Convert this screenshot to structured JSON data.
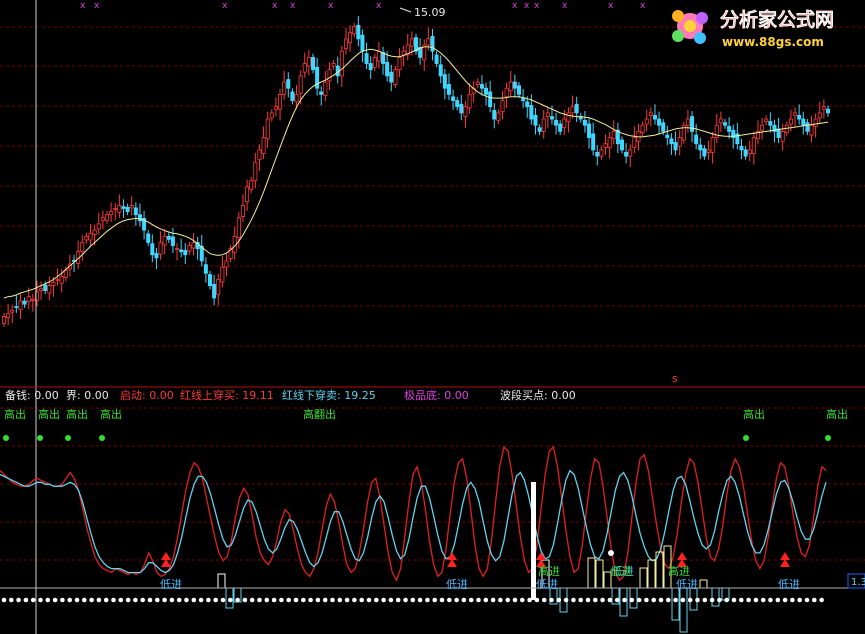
{
  "logo": {
    "title": "分析家公式网",
    "url": "www.88gs.com"
  },
  "colors": {
    "bg": "#000000",
    "grid": "#7a0000",
    "candle_up": "#ff3a3a",
    "candle_down": "#3fd7ff",
    "ma": "#f2ef9c",
    "osc_red": "#e02020",
    "osc_cyan": "#5fd3ee",
    "high_dot": "#33dd33",
    "high_label": "#33dd33",
    "low_label": "#49b7ff",
    "arrow": "#ff2020",
    "dotline": "#ffffff",
    "magenta": "#e040e0",
    "text_white": "#e8e8e8",
    "text_red": "#ff3a3a"
  },
  "top_panel": {
    "peak_label": "15.09",
    "top_mark": "x",
    "bottom_mark": "s"
  },
  "indicator_header": [
    {
      "label": "备钱:",
      "value": "0.00",
      "color": "#e8e8e8"
    },
    {
      "label": "界:",
      "value": "0.00",
      "color": "#e8e8e8"
    },
    {
      "label": "启动:",
      "value": "0.00",
      "color": "#ff3a3a"
    },
    {
      "label": "红线上穿买:",
      "value": "19.11",
      "color": "#ff3a3a"
    },
    {
      "label": "红线下穿卖:",
      "value": "19.25",
      "color": "#5fd3ee"
    },
    {
      "label": "极品底:",
      "value": "0.00",
      "color": "#e040e0"
    },
    {
      "label": "波段买点:",
      "value": "0.00",
      "color": "#e8e8e8"
    }
  ],
  "bottom_panel": {
    "right_value": "1.3",
    "high_labels": [
      "高出",
      "高出",
      "高出",
      "高出",
      "高翻出",
      "高出",
      "高出"
    ],
    "low_labels": [
      "低进",
      "低进",
      "低进",
      "低进",
      "低进",
      "低进"
    ],
    "green_labels": [
      "高进",
      "低进",
      "高进"
    ]
  },
  "chart_data": [
    {
      "type": "candlestick",
      "title": "",
      "peak_price": 15.09,
      "candles_count": 205,
      "grid": true,
      "ma_series": [
        {
          "name": "",
          "values": [
            10.6,
            10.62,
            10.63,
            10.65,
            10.68,
            10.7,
            10.72,
            10.74,
            10.77,
            10.8,
            10.83,
            10.86,
            10.9,
            10.95,
            11.0,
            11.06,
            11.12,
            11.18,
            11.24,
            11.3,
            11.37,
            11.44,
            11.5,
            11.56,
            11.62,
            11.68,
            11.73,
            11.78,
            11.82,
            11.85,
            11.87,
            11.88,
            11.89,
            11.88,
            11.86,
            11.83,
            11.79,
            11.75,
            11.72,
            11.69,
            11.67,
            11.65,
            11.64,
            11.62,
            11.6,
            11.57,
            11.53,
            11.48,
            11.42,
            11.37,
            11.32,
            11.3,
            11.29,
            11.3,
            11.33,
            11.38,
            11.44,
            11.52,
            11.62,
            11.74,
            11.86,
            12.0,
            12.15,
            12.32,
            12.5,
            12.68,
            12.86,
            13.04,
            13.22,
            13.39,
            13.55,
            13.69,
            13.81,
            13.9,
            13.97,
            14.03,
            14.07,
            14.1,
            14.13,
            14.17,
            14.21,
            14.26,
            14.31,
            14.37,
            14.44,
            14.5,
            14.56,
            14.6,
            14.62,
            14.63,
            14.62,
            14.6,
            14.57,
            14.54,
            14.52,
            14.51,
            14.51,
            14.53,
            14.56,
            14.59,
            14.62,
            14.65,
            14.67,
            14.67,
            14.66,
            14.62,
            14.57,
            14.51,
            14.44,
            14.36,
            14.28,
            14.2,
            14.12,
            14.05,
            13.99,
            13.94,
            13.9,
            13.87,
            13.85,
            13.84,
            13.84,
            13.84,
            13.85,
            13.86,
            13.86,
            13.86,
            13.85,
            13.83,
            13.81,
            13.78,
            13.75,
            13.72,
            13.69,
            13.66,
            13.63,
            13.6,
            13.58,
            13.56,
            13.55,
            13.54,
            13.54,
            13.53,
            13.52,
            13.5,
            13.47,
            13.44,
            13.41,
            13.37,
            13.33,
            13.3,
            13.27,
            13.25,
            13.23,
            13.22,
            13.21,
            13.21,
            13.22,
            13.23,
            13.24,
            13.26,
            13.28,
            13.3,
            13.32,
            13.34,
            13.35,
            13.36,
            13.36,
            13.35,
            13.34,
            13.32,
            13.3,
            13.28,
            13.26,
            13.24,
            13.23,
            13.22,
            13.22,
            13.22,
            13.23,
            13.24,
            13.25,
            13.26,
            13.27,
            13.28,
            13.29,
            13.3,
            13.31,
            13.32,
            13.33,
            13.34,
            13.35,
            13.36,
            13.37,
            13.38,
            13.39,
            13.4,
            13.41,
            13.42,
            13.43,
            13.44,
            13.45
          ]
        }
      ],
      "closes": [
        10.3,
        10.35,
        10.4,
        10.45,
        10.55,
        10.5,
        10.62,
        10.58,
        10.7,
        10.75,
        10.72,
        10.8,
        10.85,
        10.9,
        10.95,
        11.05,
        11.15,
        11.2,
        11.35,
        11.5,
        11.6,
        11.65,
        11.7,
        11.8,
        11.9,
        11.95,
        12.0,
        12.05,
        12.1,
        12.05,
        12.0,
        12.1,
        11.95,
        11.85,
        11.7,
        11.5,
        11.3,
        11.25,
        11.5,
        11.6,
        11.55,
        11.45,
        11.4,
        11.35,
        11.3,
        11.45,
        11.5,
        11.4,
        11.2,
        11.0,
        10.8,
        10.6,
        10.9,
        11.1,
        11.2,
        11.4,
        11.6,
        11.9,
        12.1,
        12.4,
        12.5,
        12.8,
        13.0,
        13.2,
        13.5,
        13.6,
        13.7,
        13.9,
        14.1,
        14.0,
        13.8,
        13.9,
        14.2,
        14.4,
        14.5,
        14.3,
        14.0,
        13.9,
        14.1,
        14.3,
        14.4,
        14.2,
        14.6,
        14.8,
        14.9,
        15.0,
        14.8,
        14.6,
        14.4,
        14.3,
        14.5,
        14.6,
        14.4,
        14.2,
        14.1,
        14.3,
        14.5,
        14.6,
        14.7,
        14.8,
        14.6,
        14.5,
        14.7,
        14.8,
        14.6,
        14.4,
        14.2,
        14.0,
        13.9,
        13.8,
        13.7,
        13.6,
        13.7,
        13.9,
        14.0,
        14.1,
        14.0,
        13.9,
        13.7,
        13.5,
        13.6,
        13.8,
        14.0,
        14.1,
        14.0,
        13.9,
        13.8,
        13.7,
        13.5,
        13.4,
        13.3,
        13.5,
        13.6,
        13.5,
        13.4,
        13.3,
        13.5,
        13.6,
        13.7,
        13.6,
        13.5,
        13.4,
        13.2,
        13.0,
        12.9,
        13.0,
        13.1,
        13.2,
        13.3,
        13.1,
        13.0,
        12.9,
        13.0,
        13.2,
        13.3,
        13.4,
        13.5,
        13.6,
        13.5,
        13.4,
        13.3,
        13.2,
        13.1,
        13.0,
        13.2,
        13.4,
        13.5,
        13.3,
        13.1,
        13.0,
        12.9,
        13.0,
        13.2,
        13.4,
        13.5,
        13.4,
        13.3,
        13.2,
        13.1,
        13.0,
        12.9,
        13.0,
        13.2,
        13.3,
        13.4,
        13.5,
        13.4,
        13.3,
        13.2,
        13.3,
        13.4,
        13.5,
        13.6,
        13.5,
        13.4,
        13.3,
        13.4,
        13.5,
        13.6,
        13.7,
        13.6
      ]
    },
    {
      "type": "line",
      "title": "",
      "series": [
        {
          "name": "",
          "values": [
            64,
            62,
            60,
            58,
            57,
            56,
            56,
            57,
            59,
            60,
            59,
            58,
            57,
            56,
            56,
            57,
            60,
            63,
            60,
            54,
            45,
            35,
            27,
            20,
            16,
            14,
            13,
            12,
            14,
            13,
            12,
            11,
            12,
            11,
            12,
            16,
            22,
            18,
            12,
            10,
            11,
            14,
            20,
            30,
            42,
            54,
            63,
            68,
            66,
            60,
            50,
            40,
            30,
            22,
            18,
            20,
            28,
            40,
            50,
            55,
            52,
            42,
            30,
            22,
            18,
            16,
            20,
            28,
            38,
            44,
            42,
            34,
            24,
            16,
            12,
            10,
            14,
            22,
            34,
            46,
            52,
            48,
            38,
            26,
            16,
            12,
            14,
            22,
            34,
            48,
            58,
            60,
            50,
            36,
            22,
            12,
            8,
            14,
            30,
            48,
            62,
            66,
            58,
            44,
            28,
            16,
            10,
            12,
            24,
            42,
            58,
            68,
            70,
            60,
            44,
            26,
            14,
            10,
            14,
            28,
            48,
            66,
            76,
            74,
            62,
            46,
            30,
            18,
            12,
            14,
            26,
            44,
            62,
            74,
            76,
            66,
            50,
            34,
            20,
            12,
            14,
            26,
            44,
            60,
            70,
            68,
            56,
            40,
            24,
            12,
            8,
            10,
            22,
            40,
            58,
            70,
            72,
            64,
            50,
            36,
            24,
            16,
            14,
            20,
            32,
            48,
            62,
            70,
            68,
            58,
            44,
            30,
            20,
            18,
            24,
            36,
            52,
            64,
            70,
            66,
            56,
            42,
            28,
            18,
            14,
            18,
            30,
            46,
            60,
            68,
            66,
            56,
            42,
            30,
            22,
            20,
            26,
            40,
            56,
            66,
            64
          ]
        },
        {
          "name": "",
          "values": [
            62,
            61,
            60,
            59,
            58,
            57,
            56,
            56,
            57,
            58,
            58,
            57,
            57,
            56,
            56,
            56,
            57,
            58,
            57,
            54,
            48,
            40,
            32,
            25,
            20,
            17,
            15,
            14,
            14,
            14,
            13,
            12,
            12,
            12,
            12,
            14,
            17,
            17,
            15,
            13,
            12,
            13,
            16,
            22,
            30,
            40,
            50,
            57,
            61,
            61,
            58,
            52,
            44,
            36,
            29,
            25,
            26,
            31,
            38,
            45,
            49,
            48,
            43,
            36,
            29,
            24,
            22,
            24,
            29,
            35,
            39,
            38,
            34,
            28,
            22,
            17,
            15,
            17,
            22,
            30,
            38,
            43,
            43,
            38,
            31,
            24,
            19,
            18,
            22,
            30,
            40,
            48,
            51,
            48,
            40,
            31,
            23,
            19,
            21,
            29,
            40,
            50,
            56,
            56,
            50,
            41,
            31,
            23,
            19,
            20,
            26,
            36,
            47,
            55,
            58,
            55,
            48,
            38,
            28,
            21,
            18,
            20,
            28,
            40,
            52,
            61,
            63,
            59,
            51,
            41,
            31,
            23,
            19,
            20,
            26,
            37,
            49,
            59,
            64,
            62,
            55,
            45,
            35,
            26,
            20,
            19,
            23,
            32,
            43,
            54,
            61,
            63,
            59,
            51,
            41,
            32,
            25,
            20,
            18,
            19,
            24,
            33,
            44,
            54,
            60,
            61,
            57,
            49,
            40,
            32,
            26,
            24,
            26,
            33,
            43,
            52,
            59,
            61,
            58,
            51,
            42,
            33,
            26,
            22,
            22,
            26,
            34,
            43,
            52,
            58,
            59,
            55,
            48,
            40,
            33,
            29,
            29,
            34,
            42,
            51,
            58
          ]
        }
      ]
    }
  ]
}
